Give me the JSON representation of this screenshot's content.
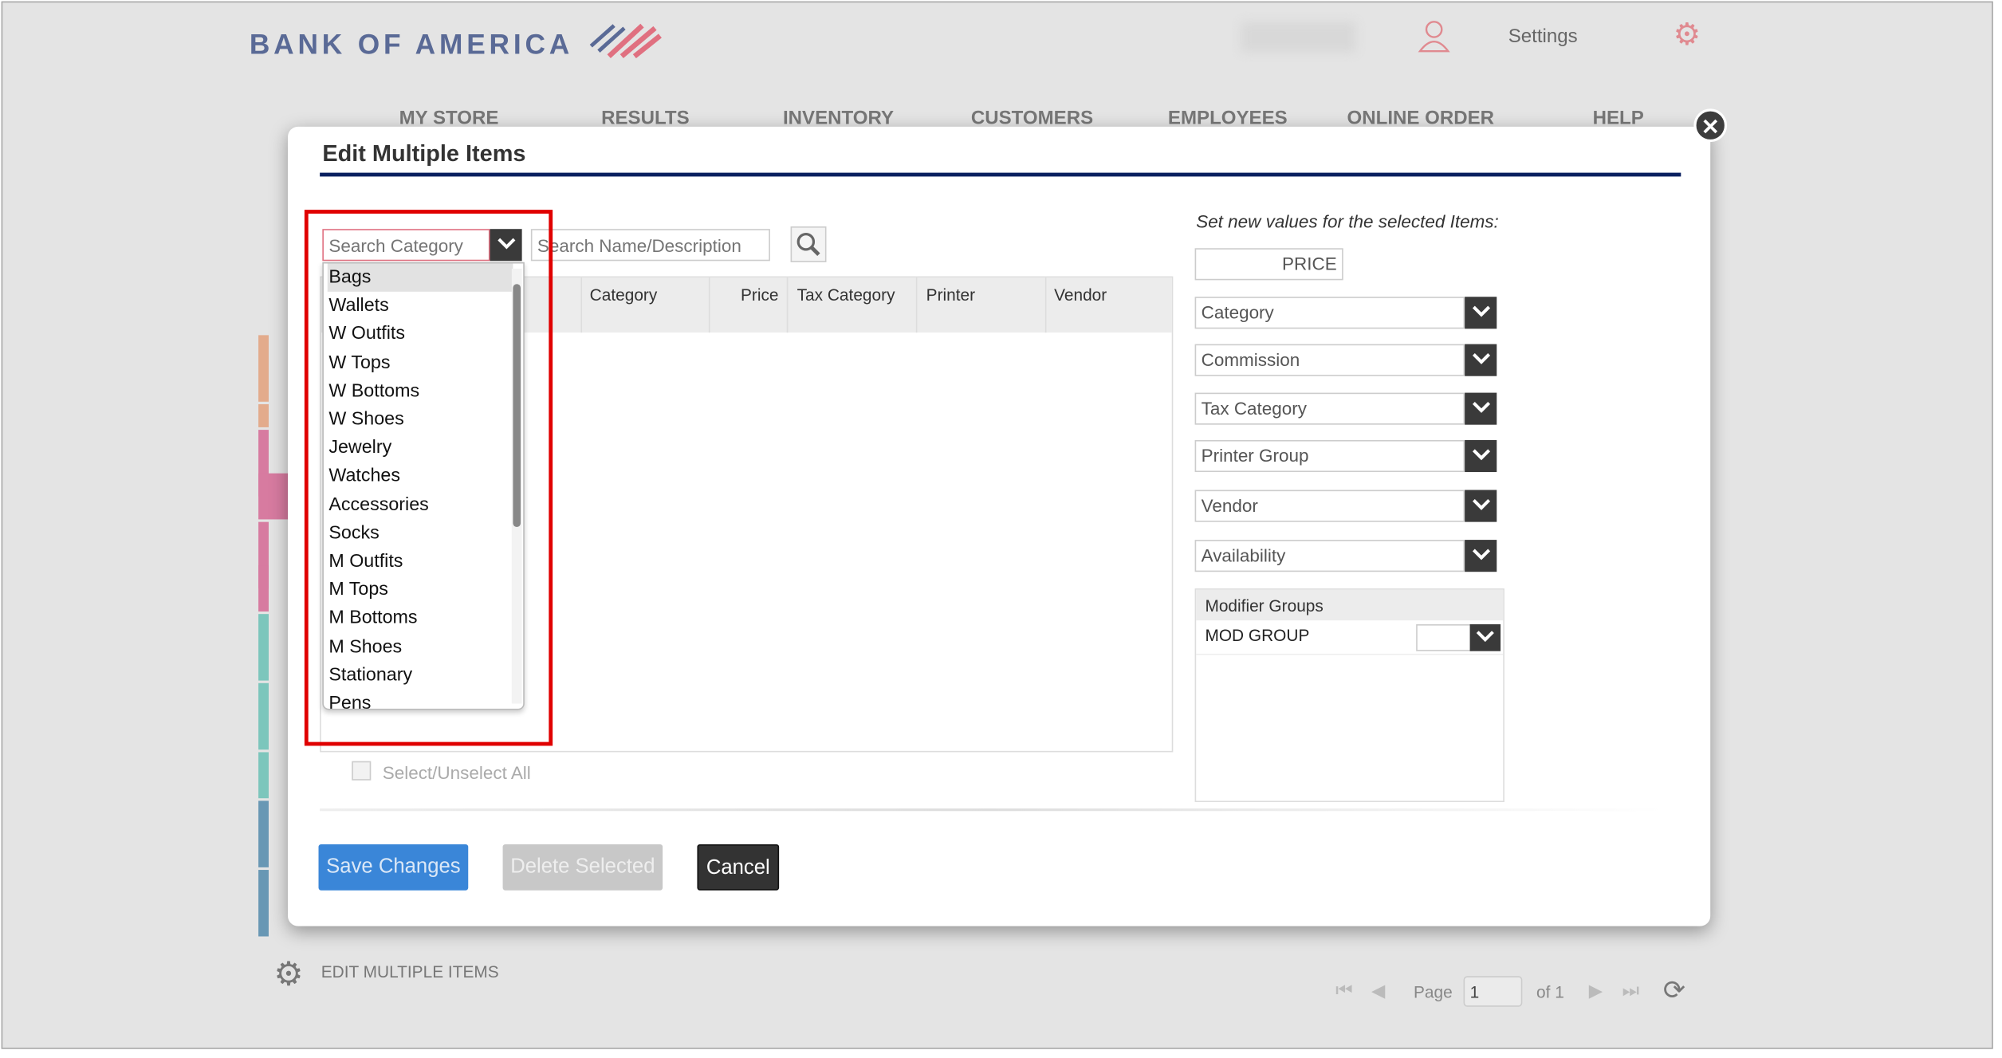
{
  "header": {
    "brand": "BANK OF AMERICA",
    "settings_label": "Settings",
    "user_icon": "user-icon",
    "settings_icon": "gear-icon"
  },
  "nav": [
    "MY STORE",
    "RESULTS",
    "INVENTORY",
    "CUSTOMERS",
    "EMPLOYEES",
    "ONLINE ORDER",
    "HELP"
  ],
  "modal": {
    "title": "Edit Multiple Items",
    "search_category_placeholder": "Search Category",
    "search_name_placeholder": "Search Name/Description",
    "columns": [
      "Category",
      "Price",
      "Tax Category",
      "Printer",
      "Vendor"
    ],
    "category_options": [
      "Bags",
      "Wallets",
      "W Outfits",
      "W Tops",
      "W Bottoms",
      "W Shoes",
      "Jewelry",
      "Watches",
      "Accessories",
      "Socks",
      "M Outfits",
      "M Tops",
      "M Bottoms",
      "M Shoes",
      "Stationary",
      "Pens"
    ],
    "selected_option": "Bags",
    "select_all_label": "Select/Unselect All",
    "right": {
      "heading": "Set new values for the selected Items:",
      "price_placeholder": "PRICE",
      "selects": [
        "Category",
        "Commission",
        "Tax Category",
        "Printer Group",
        "Vendor",
        "Availability"
      ],
      "modifier_groups_header": "Modifier Groups",
      "modifier_row": "MOD GROUP"
    },
    "buttons": {
      "save": "Save Changes",
      "delete": "Delete Selected",
      "cancel": "Cancel"
    }
  },
  "footer": {
    "section_label": "EDIT MULTIPLE ITEMS",
    "page_label": "Page",
    "page_value": "1",
    "of_label": "of 1"
  },
  "colors": {
    "accent_blue": "#3a86d8",
    "highlight_red": "#e00000",
    "rule_navy": "#0a2060"
  }
}
